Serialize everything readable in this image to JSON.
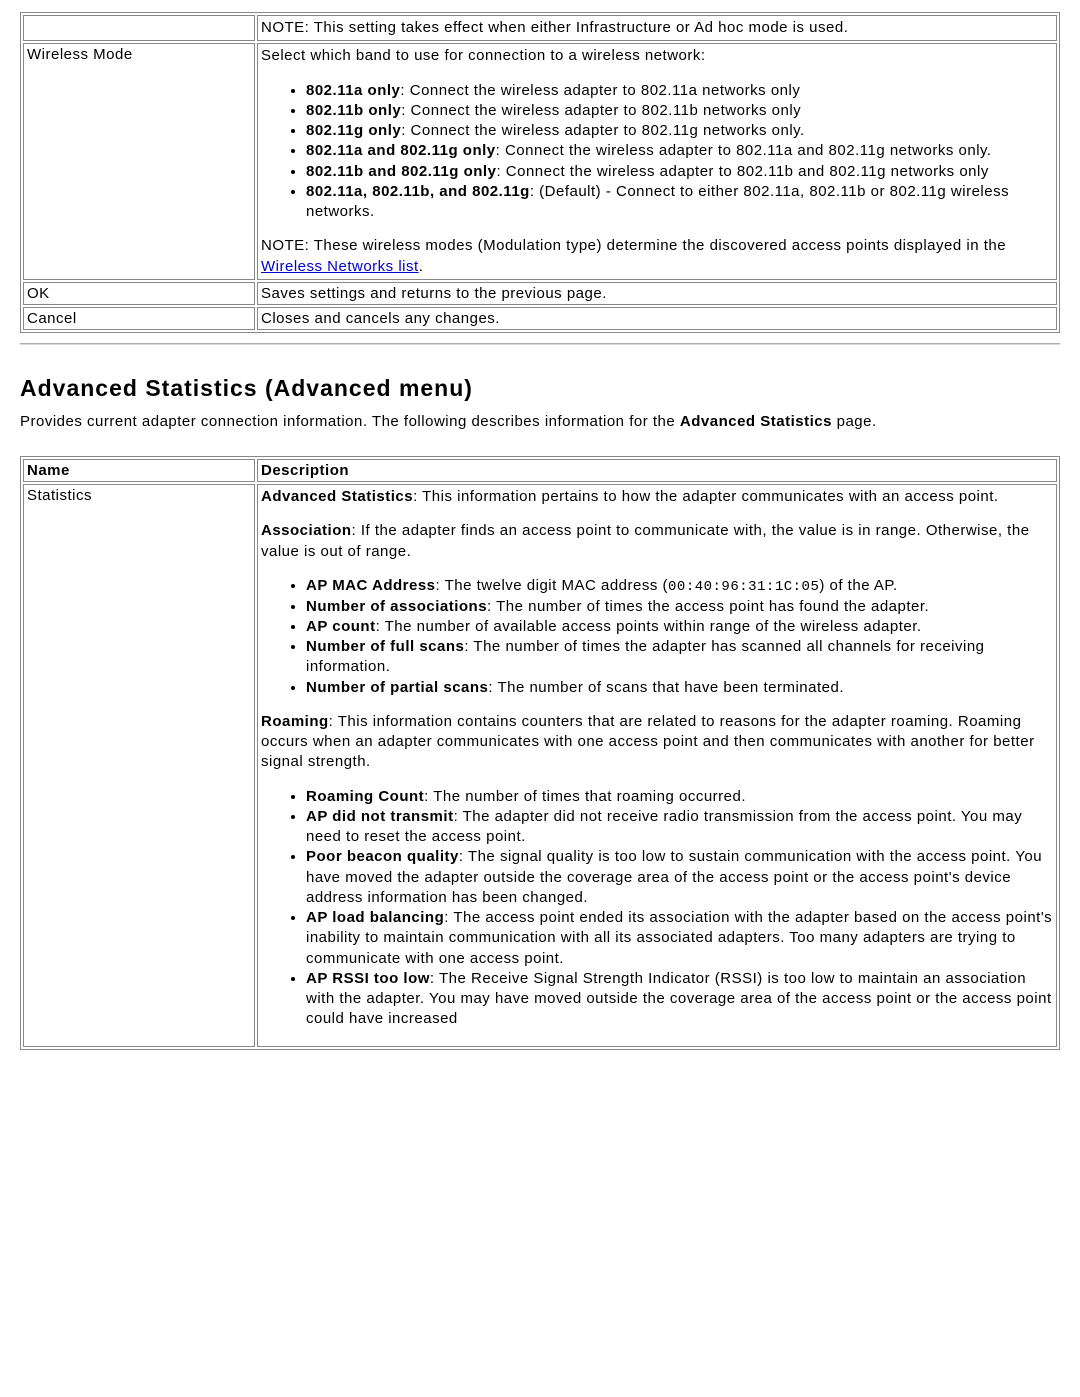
{
  "table1": {
    "r0": {
      "name": "",
      "note": "NOTE: This setting takes effect when either Infrastructure or Ad hoc mode is used."
    },
    "r1": {
      "name": "Wireless Mode",
      "intro": "Select which band to use for connection to a wireless network:",
      "items": [
        {
          "b": "802.11a only",
          "rest": ": Connect the wireless adapter to 802.11a networks only"
        },
        {
          "b": "802.11b only",
          "rest": ": Connect the wireless adapter to 802.11b networks only"
        },
        {
          "b": "802.11g only",
          "rest": ": Connect the wireless adapter to 802.11g networks only."
        },
        {
          "b": "802.11a and 802.11g only",
          "rest": ": Connect the wireless adapter to 802.11a and 802.11g networks only."
        },
        {
          "b": "802.11b and 802.11g only",
          "rest": ": Connect the wireless adapter to 802.11b and 802.11g networks only"
        },
        {
          "b": "802.11a, 802.11b, and 802.11g",
          "rest": ": (Default) - Connect to either 802.11a, 802.11b or 802.11g wireless networks."
        }
      ],
      "note_pre": "NOTE: These wireless modes (Modulation type) determine the discovered access points displayed in the ",
      "note_link": "Wireless Networks list",
      "note_post": "."
    },
    "r2": {
      "name": "OK",
      "desc": "Saves settings and returns to the previous page."
    },
    "r3": {
      "name": "Cancel",
      "desc": "Closes and cancels any changes."
    }
  },
  "section": {
    "heading": "Advanced Statistics (Advanced menu)",
    "intro_pre": "Provides current adapter connection information. The following describes information for the ",
    "intro_b": "Advanced Statistics",
    "intro_post": " page."
  },
  "table2": {
    "head": {
      "c0": "Name",
      "c1": "Description"
    },
    "r0": {
      "name": "Statistics",
      "p1_b": "Advanced Statistics",
      "p1_rest": ": This information pertains to how the adapter communicates with an access point.",
      "p2_b": "Association",
      "p2_rest": ": If the adapter finds an access point to communicate with, the value is in range. Otherwise, the value is out of range.",
      "assoc_items": [
        {
          "b": "AP MAC Address",
          "pre": ": The twelve digit MAC address (",
          "code": "00:40:96:31:1C:05",
          "post": ") of the AP."
        },
        {
          "b": "Number of associations",
          "rest": ": The number of times the access point has found the adapter."
        },
        {
          "b": "AP count",
          "rest": ": The number of available access points within range of the wireless adapter."
        },
        {
          "b": "Number of full scans",
          "rest": ": The number of times the adapter has scanned all channels for receiving information."
        },
        {
          "b": "Number of partial scans",
          "rest": ": The number of scans that have been terminated."
        }
      ],
      "p3_b": "Roaming",
      "p3_rest": ": This information contains counters that are related to reasons for the adapter roaming. Roaming occurs when an adapter communicates with one access point and then communicates with another for better signal strength.",
      "roam_items": [
        {
          "b": "Roaming Count",
          "rest": ": The number of times that roaming occurred."
        },
        {
          "b": "AP did not transmit",
          "rest": ": The adapter did not receive radio transmission from the access point. You may need to reset the access point."
        },
        {
          "b": "Poor beacon quality",
          "rest": ": The signal quality is too low to sustain communication with the access point. You have moved the adapter outside the coverage area of the access point or the access point's device address information has been changed."
        },
        {
          "b": "AP load balancing",
          "rest": ": The access point ended its association with the adapter based on the access point's inability to maintain communication with all its associated adapters. Too many adapters are trying to communicate with one access point."
        },
        {
          "b": "AP RSSI too low",
          "rest": ": The Receive Signal Strength Indicator (RSSI) is too low to maintain an association with the adapter. You may have moved outside the coverage area of the access point or the access point could have increased"
        }
      ]
    }
  }
}
